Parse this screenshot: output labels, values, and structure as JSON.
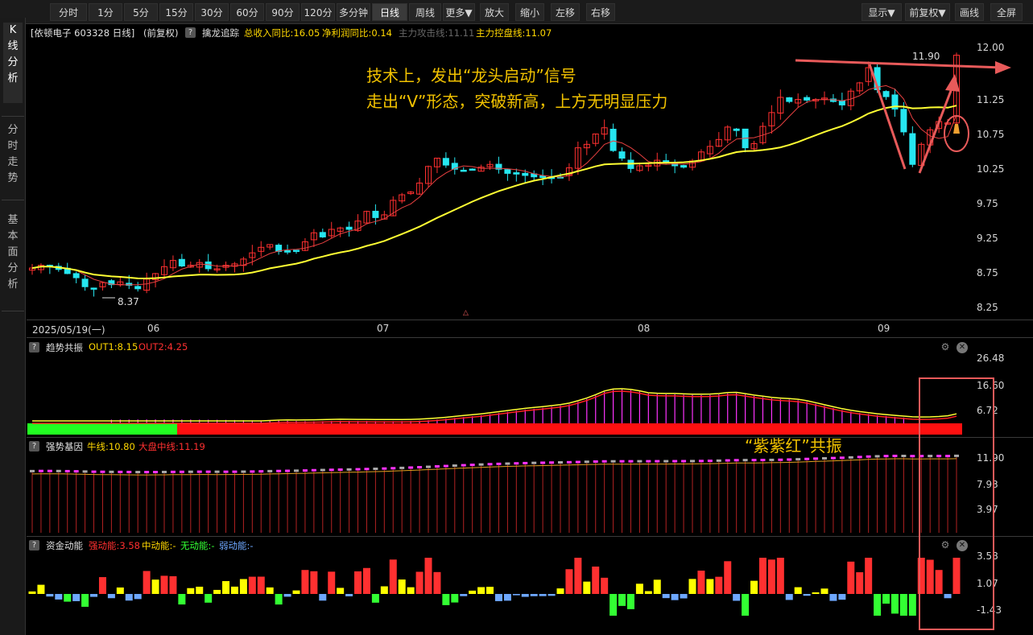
{
  "toolbar": {
    "tabs": [
      "分时",
      "1分",
      "5分",
      "15分",
      "30分",
      "60分",
      "90分",
      "120分",
      "多分钟",
      "日线",
      "周线",
      "更多▼",
      "放大",
      "缩小",
      "左移",
      "右移"
    ],
    "active": "日线",
    "right": [
      "显示▼",
      "前复权▼",
      "画线",
      "全屏"
    ]
  },
  "leftnav": [
    "K\n线\n分\n析",
    "分\n时\n走\n势",
    "基\n本\n面\n分\n析"
  ],
  "main": {
    "stock": "[依顿电子 603328 日线]",
    "adj": "(前复权)",
    "indicator_name": "擒龙追踪",
    "ind1": "总收入同比:16.05",
    "ind2": "净利润同比:0.14",
    "ind3": "主力攻击线:11.11",
    "ind4": "主力控盘线:11.07",
    "yaxis": [
      "12.00",
      "11.25",
      "10.75",
      "10.25",
      "9.75",
      "9.25",
      "8.75",
      "8.25"
    ],
    "price_high": "11.90",
    "price_low": "8.37",
    "annotation1": "技术上，发出“龙头启动”信号",
    "annotation2": "走出“V”形态，突破新高，上方无明显压力",
    "marker": "△",
    "dates": [
      "2025/05/19(一)",
      "06",
      "07",
      "08",
      "09"
    ]
  },
  "panel1": {
    "title": "趋势共振",
    "out1": "OUT1:8.15",
    "out2": "OUT2:4.25",
    "yaxis": [
      "26.48",
      "16.60",
      "6.72"
    ],
    "note": "“紫紫红”共振"
  },
  "panel2": {
    "title": "强势基因",
    "bull": "牛线:10.80",
    "market": "大盘中线:11.19",
    "yaxis": [
      "11.90",
      "7.93",
      "3.97"
    ]
  },
  "panel3": {
    "title": "资金动能",
    "strong": "强动能:3.58",
    "mid": "中动能:-",
    "none": "无动能:-",
    "weak": "弱动能:-",
    "yaxis": [
      "3.58",
      "1.07",
      "-1.43"
    ]
  },
  "colors": {
    "up": "#ff3030",
    "down": "#26e6f0",
    "ma_slow": "#ffff33",
    "accent": "#e85a5a",
    "annotation": "#f2c200",
    "magenta": "#ff33ff",
    "green": "#33ff33"
  },
  "chart_data": {
    "type": "candlestick",
    "ylim": [
      8.25,
      12.0
    ],
    "closes": [
      8.82,
      8.86,
      8.84,
      8.8,
      8.74,
      8.68,
      8.55,
      8.52,
      8.61,
      8.58,
      8.62,
      8.57,
      8.52,
      8.66,
      8.74,
      8.84,
      8.93,
      8.85,
      8.86,
      8.9,
      8.81,
      8.81,
      8.86,
      8.88,
      8.95,
      9.04,
      9.12,
      9.16,
      9.06,
      9.05,
      9.07,
      9.2,
      9.33,
      9.27,
      9.38,
      9.4,
      9.38,
      9.5,
      9.64,
      9.55,
      9.59,
      9.8,
      9.88,
      9.92,
      10.05,
      10.29,
      10.41,
      10.31,
      10.25,
      10.23,
      10.24,
      10.28,
      10.32,
      10.25,
      10.19,
      10.18,
      10.16,
      10.14,
      10.13,
      10.12,
      10.13,
      10.27,
      10.56,
      10.61,
      10.76,
      10.85,
      10.52,
      10.41,
      10.26,
      10.3,
      10.31,
      10.38,
      10.35,
      10.3,
      10.28,
      10.37,
      10.5,
      10.58,
      10.68,
      10.86,
      10.81,
      10.56,
      10.62,
      10.87,
      11.07,
      11.29,
      11.23,
      11.26,
      11.25,
      11.26,
      11.28,
      11.23,
      11.18,
      11.38,
      11.5,
      11.72,
      11.4,
      11.3,
      11.12,
      10.79,
      10.32,
      10.61,
      10.82,
      10.94,
      10.92,
      11.9
    ]
  }
}
